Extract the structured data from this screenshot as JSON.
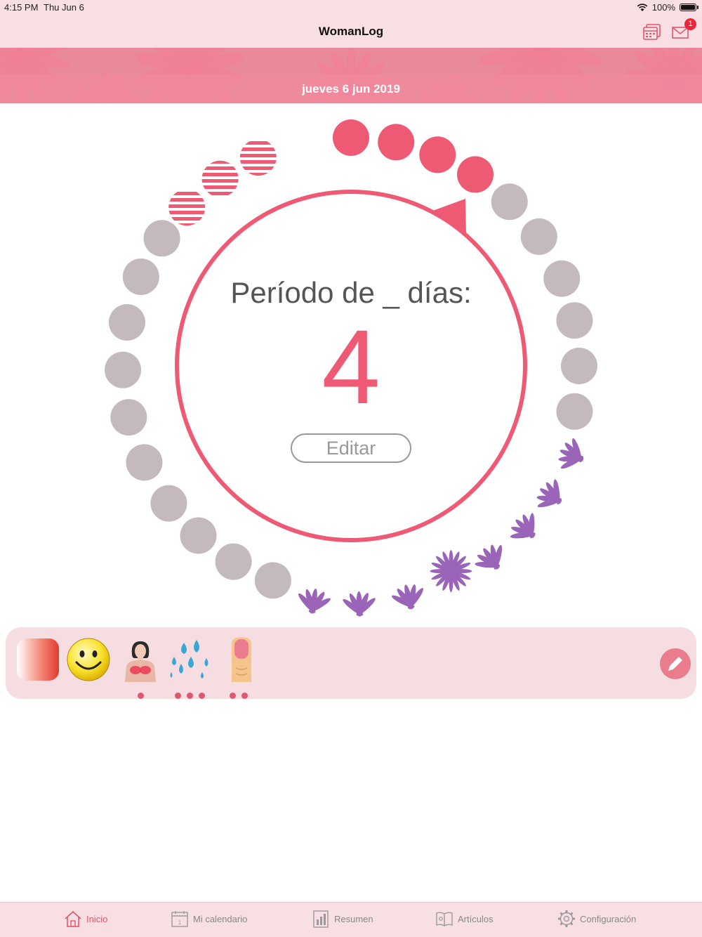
{
  "status_bar": {
    "time": "4:15 PM",
    "date": "Thu Jun 6",
    "battery": "100%"
  },
  "nav": {
    "title": "WomanLog",
    "mail_badge": "1"
  },
  "banner": {
    "date": "jueves 6 jun 2019"
  },
  "cycle": {
    "label": "Período de _ días:",
    "value": "4",
    "edit_label": "Editar",
    "colors": {
      "period": "#ee5a73",
      "normal": "#c4b9bd",
      "fertile": "#9a64b8"
    }
  },
  "symptoms": {
    "items": [
      {
        "icon": "menstrual-flow-icon",
        "dots": 0
      },
      {
        "icon": "smiley-mood-icon",
        "dots": 0
      },
      {
        "icon": "breast-tenderness-icon",
        "dots": 1
      },
      {
        "icon": "water-drops-icon",
        "dots": 3
      },
      {
        "icon": "nail-icon",
        "dots": 2
      }
    ],
    "edit_icon": "pencil-icon"
  },
  "tabs": [
    {
      "label": "Inicio",
      "icon": "home-icon",
      "active": true
    },
    {
      "label": "Mi calendario",
      "icon": "calendar-icon",
      "active": false
    },
    {
      "label": "Resumen",
      "icon": "report-icon",
      "active": false
    },
    {
      "label": "Artículos",
      "icon": "articles-icon",
      "active": false
    },
    {
      "label": "Configuración",
      "icon": "gear-icon",
      "active": false
    }
  ]
}
